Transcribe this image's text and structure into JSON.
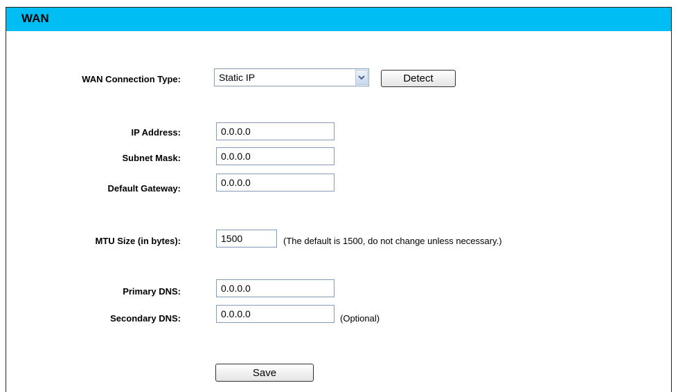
{
  "header": {
    "title": "WAN"
  },
  "connection": {
    "label": "WAN Connection Type:",
    "selected": "Static IP",
    "detect_label": "Detect"
  },
  "ip": {
    "label": "IP Address:",
    "value": "0.0.0.0"
  },
  "subnet": {
    "label": "Subnet Mask:",
    "value": "0.0.0.0"
  },
  "gateway": {
    "label": "Default Gateway:",
    "value": "0.0.0.0"
  },
  "mtu": {
    "label": "MTU Size (in bytes):",
    "value": "1500",
    "note": "(The default is 1500, do not change unless necessary.)"
  },
  "primary_dns": {
    "label": "Primary DNS:",
    "value": "0.0.0.0"
  },
  "secondary_dns": {
    "label": "Secondary DNS:",
    "value": "0.0.0.0",
    "note": "(Optional)"
  },
  "save_label": "Save",
  "colors": {
    "header_bg": "#00bdf3",
    "input_border": "#7f9db9"
  }
}
